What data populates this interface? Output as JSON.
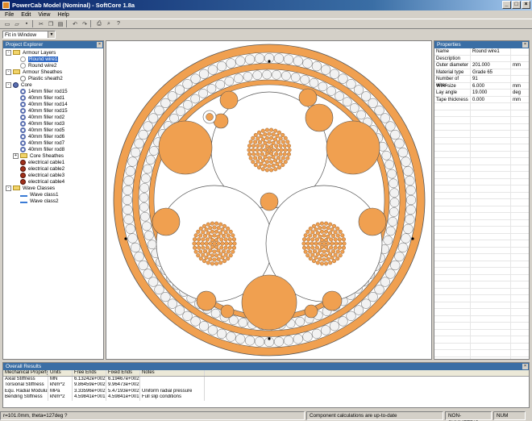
{
  "window": {
    "title": "PowerCab Model (Nominal) - SoftCore 1.8a"
  },
  "menu": [
    "File",
    "Edit",
    "View",
    "Help"
  ],
  "zoom": {
    "value": "Fit in Window"
  },
  "explorer": {
    "title": "Project Explorer",
    "items": [
      {
        "label": "Armour Layers",
        "icon": "folder",
        "depth": 0,
        "exp": "-"
      },
      {
        "label": "Round wire1",
        "icon": "wire",
        "depth": 1,
        "selected": true
      },
      {
        "label": "Round wire2",
        "icon": "wire",
        "depth": 1
      },
      {
        "label": "Armour Sheathes",
        "icon": "folder",
        "depth": 0,
        "exp": "-"
      },
      {
        "label": "Plastic sheath2",
        "icon": "sheath",
        "depth": 1
      },
      {
        "label": "Core",
        "icon": "core",
        "depth": 0,
        "exp": "-"
      },
      {
        "label": "14mm filler rod15",
        "icon": "filler",
        "depth": 1
      },
      {
        "label": "40mm filler rod1",
        "icon": "filler",
        "depth": 1
      },
      {
        "label": "40mm filler rod14",
        "icon": "filler",
        "depth": 1
      },
      {
        "label": "40mm filler rod15",
        "icon": "filler",
        "depth": 1
      },
      {
        "label": "40mm filler rod2",
        "icon": "filler",
        "depth": 1
      },
      {
        "label": "40mm filler rod3",
        "icon": "filler",
        "depth": 1
      },
      {
        "label": "40mm filler rod5",
        "icon": "filler",
        "depth": 1
      },
      {
        "label": "40mm filler rod6",
        "icon": "filler",
        "depth": 1
      },
      {
        "label": "40mm filler rod7",
        "icon": "filler",
        "depth": 1
      },
      {
        "label": "40mm filler rod8",
        "icon": "filler",
        "depth": 1
      },
      {
        "label": "Core Sheathes",
        "icon": "folder",
        "depth": 1,
        "exp": "+"
      },
      {
        "label": "electrical cable1",
        "icon": "cable",
        "depth": 1
      },
      {
        "label": "electrical cable2",
        "icon": "cable",
        "depth": 1
      },
      {
        "label": "electrical cable3",
        "icon": "cable",
        "depth": 1
      },
      {
        "label": "electrical cable4",
        "icon": "cable",
        "depth": 1
      },
      {
        "label": "Wave Classes",
        "icon": "folder",
        "depth": 0,
        "exp": "-"
      },
      {
        "label": "Wave class1",
        "icon": "wave",
        "depth": 1
      },
      {
        "label": "Wave class2",
        "icon": "wave",
        "depth": 1
      }
    ]
  },
  "properties": {
    "title": "Properties",
    "rows": [
      {
        "key": "Name",
        "value": "Round wire1",
        "unit": ""
      },
      {
        "key": "Description",
        "value": "",
        "unit": ""
      },
      {
        "key": "Outer diameter",
        "value": "201.000",
        "unit": "mm"
      },
      {
        "key": "Material type",
        "value": "Grade 65",
        "unit": ""
      },
      {
        "key": "Number of wires",
        "value": "91",
        "unit": ""
      },
      {
        "key": "Wire size",
        "value": "6.000",
        "unit": "mm"
      },
      {
        "key": "Lay angle",
        "value": "19.000",
        "unit": "deg"
      },
      {
        "key": "Tape thickness",
        "value": "0.000",
        "unit": "mm"
      }
    ]
  },
  "results": {
    "title": "Overall Results",
    "columns": [
      "Mechanical Property",
      "Units",
      "Free Ends",
      "Fixed Ends",
      "Notes"
    ],
    "rows": [
      [
        "Axial Stiffness",
        "MN",
        "6.13242e+002",
        "6.19467e+002",
        ""
      ],
      [
        "Torsional Stiffness",
        "kNm^2",
        "9.86459e+002",
        "9.96473e+002",
        ""
      ],
      [
        "Equ. Radial Modulus",
        "MPa",
        "3.33596e+002",
        "5.47193e+002",
        "Uniform radial pressure"
      ],
      [
        "Bending Stiffness",
        "kNm^2",
        "4.59841e+001",
        "4.59841e+001",
        "Full slip conditions"
      ]
    ]
  },
  "status": {
    "coords": "r=101.0mm, theta=127deg ?",
    "message": "Component calculations are up-to-date",
    "symmetry": "NON-SYMMETRIC",
    "num": "NUM"
  },
  "colors": {
    "orange": "#f0a050",
    "titlebar": "#0a246a",
    "selection": "#316ac5"
  }
}
